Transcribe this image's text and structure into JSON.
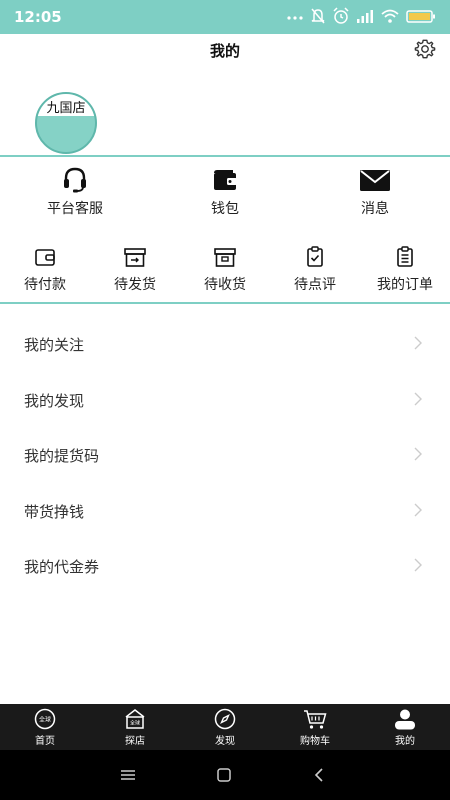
{
  "status_bar": {
    "time": "12:05",
    "icons": [
      "more-icon",
      "mute-icon",
      "alarm-icon",
      "signal-icon",
      "wifi-icon",
      "battery-icon"
    ],
    "background": "#7ecfc4"
  },
  "header": {
    "title": "我的",
    "settings_icon": "gear-icon"
  },
  "profile": {
    "avatar_text": "九国店"
  },
  "quick_actions": [
    {
      "label": "平台客服",
      "icon": "headset-icon"
    },
    {
      "label": "钱包",
      "icon": "wallet-icon"
    },
    {
      "label": "消息",
      "icon": "mail-icon"
    }
  ],
  "orders": [
    {
      "label": "待付款",
      "icon": "wallet-outline-icon"
    },
    {
      "label": "待发货",
      "icon": "box-arrow-icon"
    },
    {
      "label": "待收货",
      "icon": "box-icon"
    },
    {
      "label": "待点评",
      "icon": "clipboard-check-icon"
    },
    {
      "label": "我的订单",
      "icon": "clipboard-list-icon"
    }
  ],
  "menu": [
    {
      "label": "我的关注"
    },
    {
      "label": "我的发现"
    },
    {
      "label": "我的提货码"
    },
    {
      "label": "带货挣钱"
    },
    {
      "label": "我的代金券"
    }
  ],
  "tabbar": [
    {
      "label": "首页",
      "icon": "globe-badge-icon",
      "badge_text": "全球"
    },
    {
      "label": "探店",
      "icon": "shop-icon",
      "badge_text": "全球"
    },
    {
      "label": "发现",
      "icon": "compass-icon"
    },
    {
      "label": "购物车",
      "icon": "cart-icon"
    },
    {
      "label": "我的",
      "icon": "user-icon"
    }
  ],
  "colors": {
    "accent": "#7ecfc4",
    "avatar_fill": "#85d2c6",
    "tabbar_bg": "#1a1a1a",
    "navbar_bg": "#000000"
  }
}
